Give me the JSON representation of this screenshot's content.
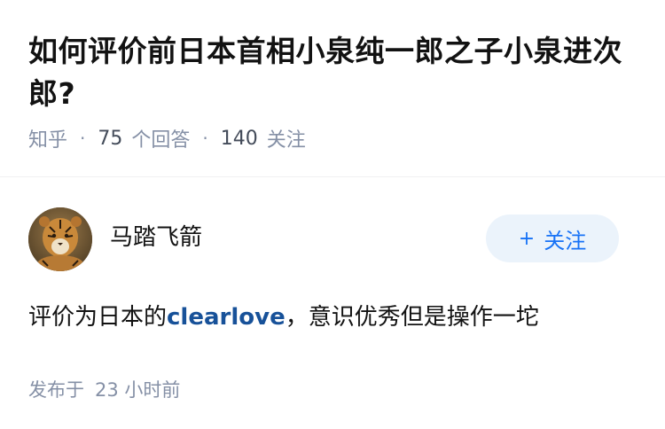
{
  "question": {
    "title": "如何评价前日本首相小泉纯一郎之子小泉进次郎?",
    "source": "知乎",
    "answer_count": "75",
    "answer_label": "个回答",
    "follow_count": "140",
    "follow_label": "关注"
  },
  "answer": {
    "author_name": "马踏飞箭",
    "follow_button": {
      "icon": "plus-icon",
      "label": "关注"
    },
    "content_before": "评价为日本的",
    "content_link": "clearlove",
    "content_after": "，意识优秀但是操作一坨",
    "posted_prefix": "发布于",
    "posted_time": "23 小时前"
  },
  "colors": {
    "meta_gray": "#8590a6",
    "link_blue": "#175199",
    "follow_blue": "#1772f6",
    "follow_bg": "#ebf3fb"
  }
}
